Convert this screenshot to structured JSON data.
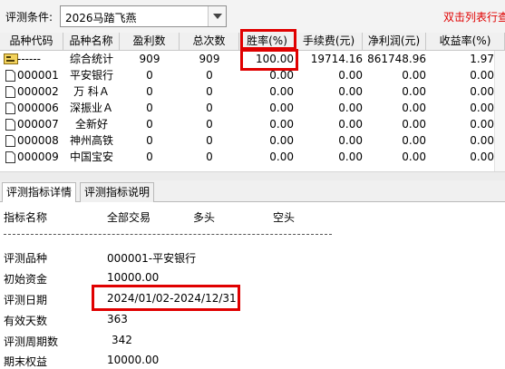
{
  "toolbar": {
    "condition_label": "评测条件:",
    "condition_value": "2026马踏飞燕",
    "hint": "双击列表行查"
  },
  "table": {
    "columns": [
      "品种代码",
      "品种名称",
      "盈利数",
      "总次数",
      "胜率(%)",
      "手续费(元)",
      "净利润(元)",
      "收益率(%)"
    ],
    "rows": [
      {
        "code": "------",
        "name": "综合统计",
        "profit": "909",
        "total": "909",
        "win": "100.00",
        "fee": "19714.16",
        "net": "861748.96",
        "ret": "1.97"
      },
      {
        "code": "000001",
        "name": "平安银行",
        "profit": "0",
        "total": "0",
        "win": "0.00",
        "fee": "0.00",
        "net": "0.00",
        "ret": "0.00"
      },
      {
        "code": "000002",
        "name": "万 科Ａ",
        "profit": "0",
        "total": "0",
        "win": "0.00",
        "fee": "0.00",
        "net": "0.00",
        "ret": "0.00"
      },
      {
        "code": "000006",
        "name": "深振业Ａ",
        "profit": "0",
        "total": "0",
        "win": "0.00",
        "fee": "0.00",
        "net": "0.00",
        "ret": "0.00"
      },
      {
        "code": "000007",
        "name": "全新好",
        "profit": "0",
        "total": "0",
        "win": "0.00",
        "fee": "0.00",
        "net": "0.00",
        "ret": "0.00"
      },
      {
        "code": "000008",
        "name": "神州高铁",
        "profit": "0",
        "total": "0",
        "win": "0.00",
        "fee": "0.00",
        "net": "0.00",
        "ret": "0.00"
      },
      {
        "code": "000009",
        "name": "中国宝安",
        "profit": "0",
        "total": "0",
        "win": "0.00",
        "fee": "0.00",
        "net": "0.00",
        "ret": "0.00"
      }
    ]
  },
  "tabs": [
    {
      "label": "评测指标详情",
      "active": true
    },
    {
      "label": "评测指标说明",
      "active": false
    }
  ],
  "detail": {
    "header": {
      "name": "指标名称",
      "all": "全部交易",
      "long": "多头",
      "short": "空头"
    },
    "items": [
      {
        "label": "评测品种",
        "value": "000001-平安银行"
      },
      {
        "label": "初始资金",
        "value": "10000.00"
      },
      {
        "label": "评测日期",
        "value": "2024/01/02-2024/12/31"
      },
      {
        "label": "有效天数",
        "value": "363"
      },
      {
        "label": "评测周期数",
        "value": "342"
      },
      {
        "label": "期末权益",
        "value": "10000.00"
      }
    ]
  },
  "colors": {
    "highlight": "#e00000",
    "hint": "#e00000",
    "header_bg": "#f0f0f0"
  },
  "icons": {
    "summary_row": "folder-sum-icon",
    "stock_row": "document-icon",
    "dropdown": "chevron-down-icon"
  }
}
